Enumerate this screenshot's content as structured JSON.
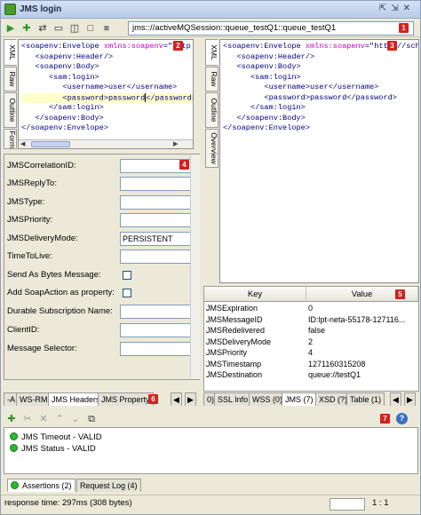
{
  "window": {
    "title": "JMS login"
  },
  "toolbar": {
    "endpoint": "jms:://activeMQSession::queue_testQ1::queue_testQ1"
  },
  "badges": [
    "1",
    "2",
    "3",
    "4",
    "5",
    "6",
    "7"
  ],
  "request_pane": {
    "tabs": [
      "XML",
      "Raw",
      "Outline",
      "Form"
    ],
    "lines": [
      {
        "pre": "<soapenv:Envelope ",
        "ns": "xmlns:soapenv",
        "post": "=\"http://sc"
      },
      {
        "pre": "   <soapenv:Header/>",
        "ns": "",
        "post": ""
      },
      {
        "pre": "   <soapenv:Body>",
        "ns": "",
        "post": ""
      },
      {
        "pre": "      <sam:login>",
        "ns": "",
        "post": ""
      },
      {
        "pre": "         <username>user</username>",
        "ns": "",
        "post": ""
      },
      {
        "pre": "         <password>password</password>",
        "ns": "",
        "post": ""
      },
      {
        "pre": "      </sam:login>",
        "ns": "",
        "post": ""
      },
      {
        "pre": "   </soapenv:Body>",
        "ns": "",
        "post": ""
      },
      {
        "pre": "</soapenv:Envelope>",
        "ns": "",
        "post": ""
      }
    ]
  },
  "response_pane": {
    "tabs": [
      "XML",
      "Raw",
      "Outline",
      "Overview"
    ],
    "lines": [
      {
        "pre": "<soapenv:Envelope ",
        "ns": "xmlns:soapenv",
        "post": "=\"http://schem"
      },
      {
        "pre": "   <soapenv:Header/>",
        "ns": "",
        "post": ""
      },
      {
        "pre": "   <soapenv:Body>",
        "ns": "",
        "post": ""
      },
      {
        "pre": "      <sam:login>",
        "ns": "",
        "post": ""
      },
      {
        "pre": "         <username>user</username>",
        "ns": "",
        "post": ""
      },
      {
        "pre": "         <password>password</password>",
        "ns": "",
        "post": ""
      },
      {
        "pre": "      </sam:login>",
        "ns": "",
        "post": ""
      },
      {
        "pre": "   </soapenv:Body>",
        "ns": "",
        "post": ""
      },
      {
        "pre": "</soapenv:Envelope>",
        "ns": "",
        "post": ""
      }
    ]
  },
  "jms_form": {
    "fields": [
      {
        "label": "JMSCorrelationID:",
        "value": ""
      },
      {
        "label": "JMSReplyTo:",
        "value": ""
      },
      {
        "label": "JMSType:",
        "value": ""
      },
      {
        "label": "JMSPriority:",
        "value": ""
      },
      {
        "label": "JMSDeliveryMode:",
        "value": "PERSISTENT"
      },
      {
        "label": "TimeToLive:",
        "value": ""
      },
      {
        "label": "Send As Bytes Message:",
        "value": ""
      },
      {
        "label": "Add SoapAction as property:",
        "value": ""
      },
      {
        "label": "Durable Subscription Name:",
        "value": ""
      },
      {
        "label": "ClientID:",
        "value": ""
      },
      {
        "label": "Message Selector:",
        "value": ""
      }
    ]
  },
  "request_tabs": [
    "-A",
    "WS-RM",
    "JMS Headers",
    "JMS Property"
  ],
  "response_tabs": [
    "0)",
    "SSL Info",
    "WSS (0)",
    "JMS (7)",
    "XSD (?)",
    "Table (1)"
  ],
  "properties": {
    "headers": [
      "Key",
      "Value"
    ],
    "rows": [
      {
        "key": "JMSExpiration",
        "value": "0"
      },
      {
        "key": "JMSMessageID",
        "value": "ID:lpt-neta-55178-127116..."
      },
      {
        "key": "JMSRedelivered",
        "value": "false"
      },
      {
        "key": "JMSDeliveryMode",
        "value": "2"
      },
      {
        "key": "JMSPriority",
        "value": "4"
      },
      {
        "key": "JMSTimestamp",
        "value": "1271160315208"
      },
      {
        "key": "JMSDestination",
        "value": "queue://testQ1"
      }
    ]
  },
  "assertions": {
    "items": [
      "JMS Timeout - VALID",
      "JMS Status - VALID"
    ],
    "tabs": [
      "Assertions (2)",
      "Request Log (4)"
    ]
  },
  "status": {
    "text": "response time: 297ms (308 bytes)",
    "position": "1 : 1"
  },
  "colors": {
    "badge": "#d4211f",
    "accent": "#2db82d",
    "xml_tag": "#000080",
    "xml_ns": "#c000c0"
  }
}
